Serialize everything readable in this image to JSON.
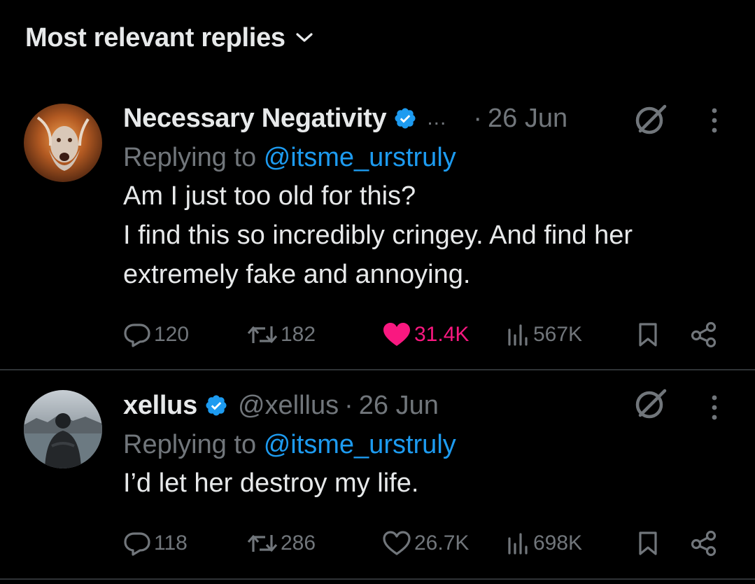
{
  "header": {
    "sort_label": "Most relevant replies",
    "sort_icon": "chevron-down-icon"
  },
  "colors": {
    "background": "#000000",
    "text_primary": "#e7e9ea",
    "text_secondary": "#71767b",
    "accent_blue": "#1d9bf0",
    "like_pink": "#f91880",
    "divider": "#2f3336"
  },
  "replies": [
    {
      "name": "Necessary Negativity",
      "verified": true,
      "handle_truncated": "...",
      "date": "26 Jun",
      "replying_prefix": "Replying to",
      "replying_to": "@itsme_urstruly",
      "text": "Am I just too old for this?\nI find this so incredibly cringey.  And find her extremely fake and annoying.",
      "stats": {
        "replies": "120",
        "retweets": "182",
        "likes": "31.4K",
        "liked": true,
        "views": "567K"
      }
    },
    {
      "name": "xellus",
      "verified": true,
      "handle": "@xelllus",
      "date": "26 Jun",
      "replying_prefix": "Replying to",
      "replying_to": "@itsme_urstruly",
      "text": "I’d let her destroy my life.",
      "stats": {
        "replies": "118",
        "retweets": "286",
        "likes": "26.7K",
        "liked": false,
        "views": "698K"
      }
    }
  ]
}
